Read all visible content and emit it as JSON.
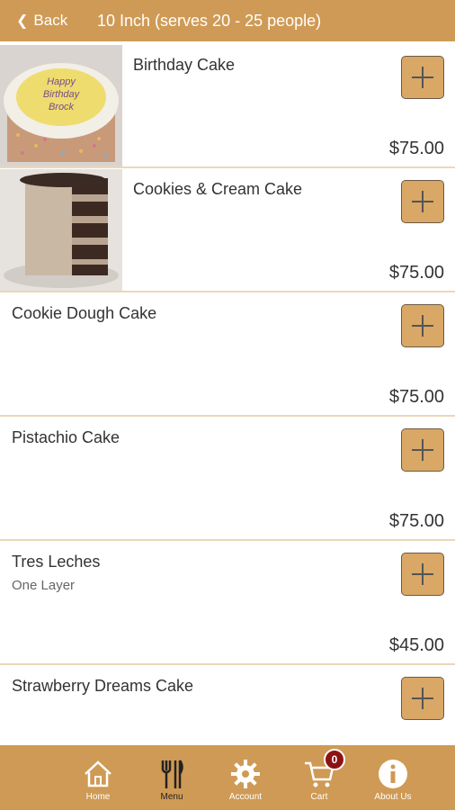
{
  "header": {
    "back_label": "Back",
    "title": "10 Inch (serves 20 - 25 people)"
  },
  "items": [
    {
      "name": "Birthday Cake",
      "sub": "",
      "price": "$75.00",
      "cake_text": [
        "Happy",
        "Birthday",
        "Brock"
      ]
    },
    {
      "name": "Cookies & Cream Cake",
      "sub": "",
      "price": "$75.00"
    },
    {
      "name": "Cookie Dough Cake",
      "sub": "",
      "price": "$75.00"
    },
    {
      "name": "Pistachio Cake",
      "sub": "",
      "price": "$75.00"
    },
    {
      "name": "Tres Leches",
      "sub": "One Layer",
      "price": "$45.00"
    },
    {
      "name": "Strawberry Dreams Cake",
      "sub": "",
      "price": ""
    }
  ],
  "tabs": [
    {
      "label": "Home",
      "icon": "home-icon"
    },
    {
      "label": "Menu",
      "icon": "utensils-icon"
    },
    {
      "label": "Account",
      "icon": "gear-icon"
    },
    {
      "label": "Cart",
      "icon": "cart-icon",
      "badge": "0"
    },
    {
      "label": "About Us",
      "icon": "info-icon"
    }
  ],
  "colors": {
    "accent": "#cf9a55",
    "button": "#d9a766",
    "divider": "#edd7b8",
    "badge": "#8b1313"
  }
}
